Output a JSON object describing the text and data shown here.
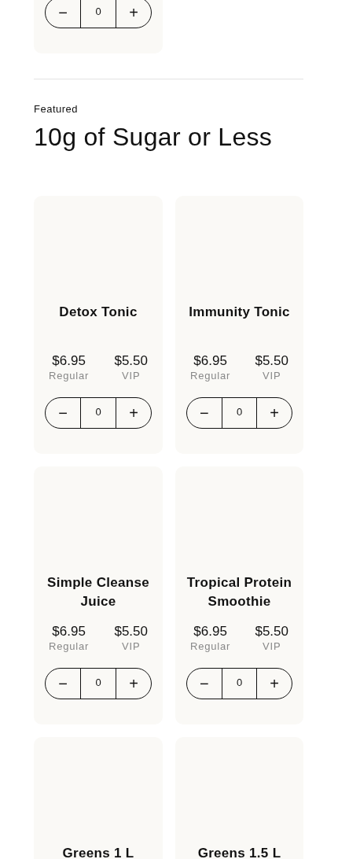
{
  "previous_card": {
    "quantity": "0",
    "decrement": "−",
    "increment": "+"
  },
  "section": {
    "eyebrow": "Featured",
    "title": "10g of Sugar or Less"
  },
  "products": [
    {
      "name": "Detox Tonic",
      "regular_price": "$6.95",
      "regular_label": "Regular",
      "vip_price": "$5.50",
      "vip_label": "VIP",
      "decrement": "−",
      "quantity": "0",
      "increment": "+"
    },
    {
      "name": "Immunity Tonic",
      "regular_price": "$6.95",
      "regular_label": "Regular",
      "vip_price": "$5.50",
      "vip_label": "VIP",
      "decrement": "−",
      "quantity": "0",
      "increment": "+"
    },
    {
      "name": "Simple Cleanse Juice",
      "regular_price": "$6.95",
      "regular_label": "Regular",
      "vip_price": "$5.50",
      "vip_label": "VIP",
      "decrement": "−",
      "quantity": "0",
      "increment": "+"
    },
    {
      "name": "Tropical Protein Smoothie",
      "regular_price": "$6.95",
      "regular_label": "Regular",
      "vip_price": "$5.50",
      "vip_label": "VIP",
      "decrement": "−",
      "quantity": "0",
      "increment": "+"
    },
    {
      "name": "Greens 1 L"
    },
    {
      "name": "Greens 1.5 L"
    }
  ]
}
